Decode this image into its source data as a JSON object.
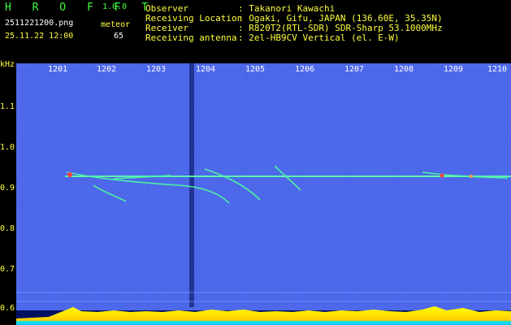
{
  "header": {
    "app_name": "H R O F F T",
    "version": "1.0.0",
    "filename": "2511221200.png",
    "meteor_label": "meteor",
    "datetime": "25.11.22 12:00",
    "meteor_count": "65"
  },
  "info": [
    {
      "label": "Observer",
      "value": ": Takanori Kawachi"
    },
    {
      "label": "Receiving Location",
      "value": ": Ogaki, Gifu, JAPAN (136.60E, 35.35N)"
    },
    {
      "label": "Receiver",
      "value": ": R820T2(RTL-SDR) SDR-Sharp 53.1000MHz"
    },
    {
      "label": "Receiving antenna",
      "value": ": 2el-HB9CV Vertical (el. E-W)"
    }
  ],
  "axis": {
    "unit": "kHz",
    "y_ticks": [
      "1.1",
      "1.0",
      "0.9",
      "0.8",
      "0.7",
      "0.6"
    ],
    "time_ticks": [
      "1201",
      "1202",
      "1203",
      "1204",
      "1205",
      "1206",
      "1207",
      "1208",
      "1209",
      "1210"
    ]
  },
  "colors": {
    "background": "#000000",
    "info_text": "#ffff3c",
    "header_text": "#3cff3c",
    "spectrogram_base": "#0a1a8c",
    "trace": "#4cff9c",
    "meteor_band": "#ffff00",
    "baseline": "#00e0ff"
  }
}
